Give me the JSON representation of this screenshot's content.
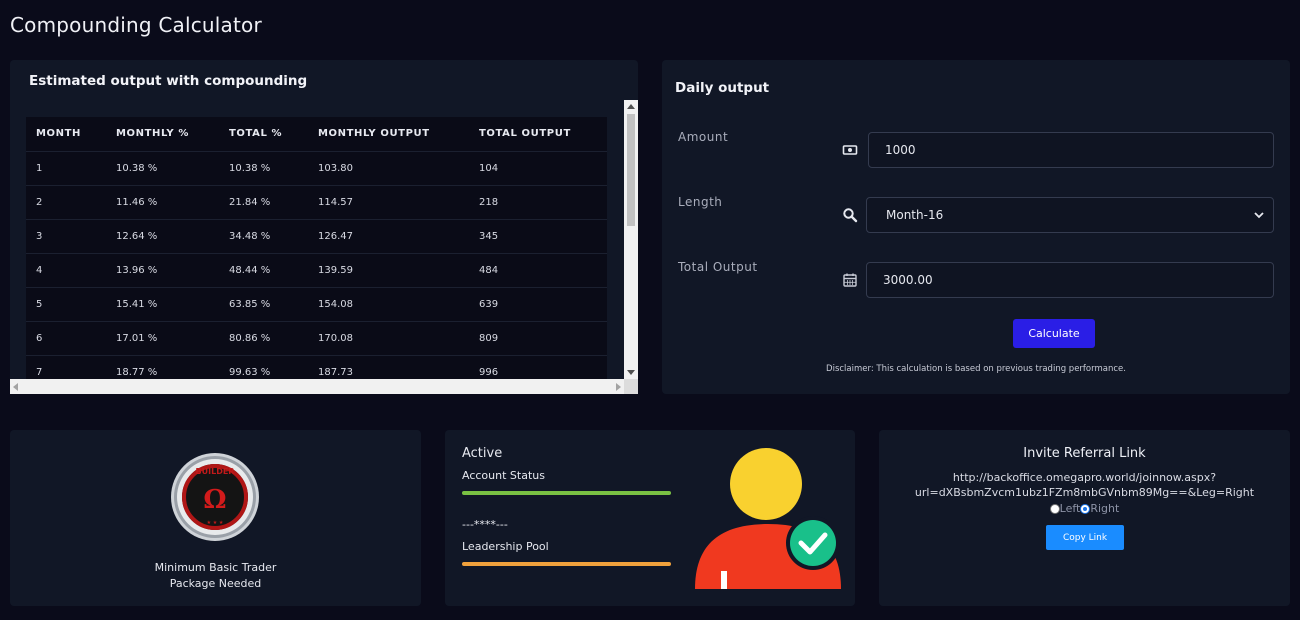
{
  "page": {
    "title": "Compounding Calculator"
  },
  "compounding": {
    "title": "Estimated output with compounding",
    "columns": [
      "MONTH",
      "MONTHLY %",
      "TOTAL %",
      "MONTHLY OUTPUT",
      "TOTAL OUTPUT"
    ],
    "rows": [
      [
        "1",
        "10.38 %",
        "10.38 %",
        "103.80",
        "104"
      ],
      [
        "2",
        "11.46 %",
        "21.84 %",
        "114.57",
        "218"
      ],
      [
        "3",
        "12.64 %",
        "34.48 %",
        "126.47",
        "345"
      ],
      [
        "4",
        "13.96 %",
        "48.44 %",
        "139.59",
        "484"
      ],
      [
        "5",
        "15.41 %",
        "63.85 %",
        "154.08",
        "639"
      ],
      [
        "6",
        "17.01 %",
        "80.86 %",
        "170.08",
        "809"
      ],
      [
        "7",
        "18.77 %",
        "99.63 %",
        "187.73",
        "996"
      ]
    ]
  },
  "daily": {
    "title": "Daily output",
    "amount_label": "Amount",
    "amount_value": "1000",
    "length_label": "Length",
    "length_value": "Month-16",
    "total_label": "Total Output",
    "total_value": "3000.00",
    "calculate_label": "Calculate",
    "disclaimer": "Disclaimer: This calculation is based on previous trading performance."
  },
  "package": {
    "badge_text": "BUILDER",
    "line1": "Minimum Basic Trader",
    "line2": "Package Needed"
  },
  "status": {
    "active_label": "Active",
    "account_status_label": "Account Status",
    "account_status_color": "#7ac143",
    "masked_value": "---****---",
    "leadership_pool_label": "Leadership Pool",
    "leadership_pool_color": "#f0a13c"
  },
  "referral": {
    "title": "Invite Referral Link",
    "link_line1": "http://backoffice.omegapro.world/joinnow.aspx?",
    "link_line2": "url=dXBsbmZvcm1ubz1FZm8mbGVnbm89Mg==&Leg=Right",
    "left_label": "Left",
    "right_label": "Right",
    "selected": "Right",
    "copy_label": "Copy Link"
  }
}
